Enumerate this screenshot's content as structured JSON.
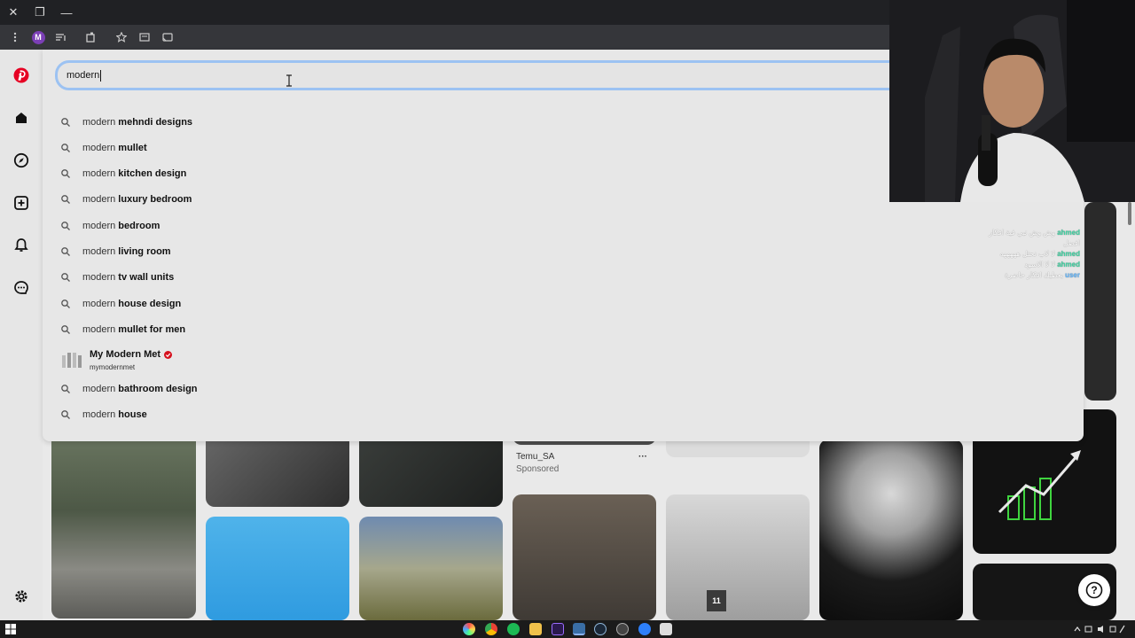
{
  "browser": {
    "window_controls": [
      "✕",
      "❐",
      "—"
    ],
    "profile_initial": "M"
  },
  "search": {
    "value": "modern",
    "suggestions": [
      {
        "base": "modern",
        "completion": "mehndi designs"
      },
      {
        "base": "modern",
        "completion": "mullet"
      },
      {
        "base": "modern",
        "completion": "kitchen design"
      },
      {
        "base": "modern",
        "completion": "luxury bedroom"
      },
      {
        "base": "modern",
        "completion": "bedroom"
      },
      {
        "base": "modern",
        "completion": "living room"
      },
      {
        "base": "modern",
        "completion": "tv wall units"
      },
      {
        "base": "modern",
        "completion": "house design"
      },
      {
        "base": "modern",
        "completion": "mullet for men"
      },
      {
        "base": "modern",
        "completion": "bathroom design"
      },
      {
        "base": "modern",
        "completion": "house"
      }
    ],
    "account": {
      "name": "My Modern Met",
      "handle": "mymodernmet"
    }
  },
  "feed": {
    "promo_title": "Temu_SA",
    "promo_label": "Sponsored",
    "more_glyph": "···",
    "tile_number": "11"
  },
  "chat": {
    "messages": [
      {
        "user": "ahmed",
        "text": "وش وش نبي فية افكار"
      },
      {
        "user": "",
        "text": "افضل"
      },
      {
        "user": "ahmed",
        "text": "لا لاب نحتل هههههه"
      },
      {
        "user": "ahmed",
        "text": "لا لا الاسود"
      },
      {
        "user": "user",
        "text": "يعطيك افكار حاضرة"
      }
    ]
  },
  "help": {
    "glyph": "?"
  },
  "colors": {
    "pinterest_red": "#e60023",
    "verified_red": "#d6111e",
    "search_border": "#9cc2f2"
  }
}
